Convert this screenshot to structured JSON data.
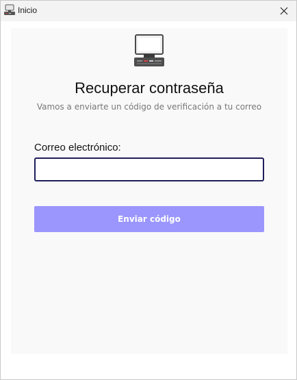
{
  "window": {
    "title": "Inicio",
    "app_icon": "monitor-icon",
    "close_icon": "close-icon"
  },
  "form": {
    "logo_icon": "computer-monitor-icon",
    "heading": "Recuperar contraseña",
    "subtitle": "Vamos a enviarte un código de verificación a tu correo",
    "email_label": "Correo electrónico:",
    "email_value": "",
    "email_placeholder": "",
    "submit_label": "Enviar código"
  },
  "colors": {
    "accent_button": "#9b96fd",
    "input_border": "#1e1e5a",
    "panel_background": "#f9f9f9"
  }
}
